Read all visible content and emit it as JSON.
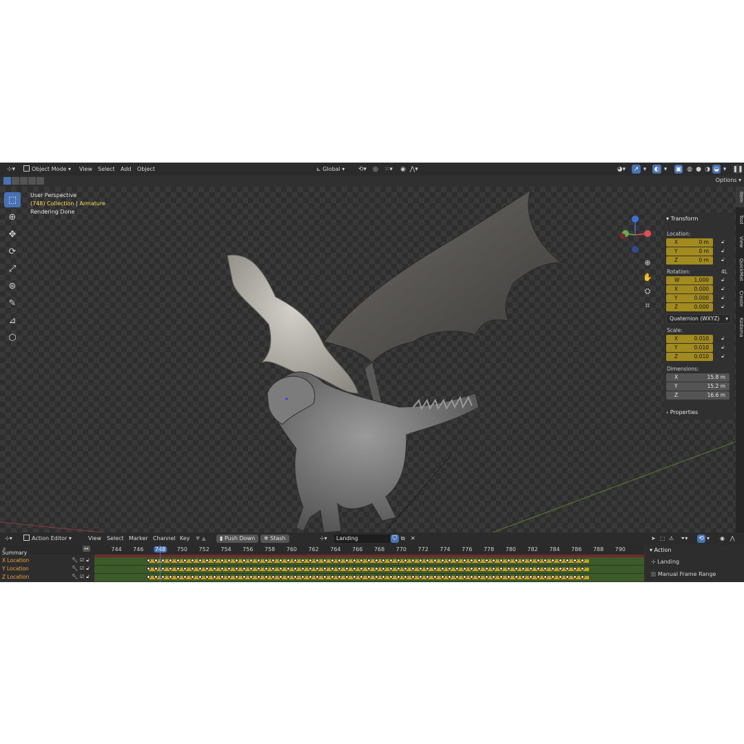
{
  "header": {
    "mode": "Object Mode",
    "menus": [
      "View",
      "Select",
      "Add",
      "Object"
    ],
    "orientation": "Global",
    "options": "Options"
  },
  "viewport": {
    "perspective": "User Perspective",
    "collection": "(748) Collection",
    "separator": "|",
    "object": "Armature",
    "status": "Rendering Done"
  },
  "transform": {
    "title": "Transform",
    "location_label": "Location:",
    "location": [
      {
        "axis": "X",
        "value": "0 m"
      },
      {
        "axis": "Y",
        "value": "0 m"
      },
      {
        "axis": "Z",
        "value": "0 m"
      }
    ],
    "rotation_label": "Rotation:",
    "rotation_mode_short": "4L",
    "rotation": [
      {
        "axis": "W",
        "value": "1.000"
      },
      {
        "axis": "X",
        "value": "0.000"
      },
      {
        "axis": "Y",
        "value": "0.000"
      },
      {
        "axis": "Z",
        "value": "0.000"
      }
    ],
    "rotation_mode": "Quaternion (WXYZ)",
    "scale_label": "Scale:",
    "scale": [
      {
        "axis": "X",
        "value": "0.010"
      },
      {
        "axis": "Y",
        "value": "0.010"
      },
      {
        "axis": "Z",
        "value": "0.010"
      }
    ],
    "dimensions_label": "Dimensions:",
    "dimensions": [
      {
        "axis": "X",
        "value": "15.8 m"
      },
      {
        "axis": "Y",
        "value": "15.2 m"
      },
      {
        "axis": "Z",
        "value": "16.6 m"
      }
    ],
    "properties": "Properties"
  },
  "side_tabs": [
    "Item",
    "Tool",
    "View",
    "QuickMat",
    "Create",
    "Kodama"
  ],
  "action_editor": {
    "mode": "Action Editor",
    "menus": [
      "View",
      "Select",
      "Marker",
      "Channel",
      "Key"
    ],
    "push_down": "Push Down",
    "stash": "Stash",
    "action_name": "Landing",
    "frames": [
      "744",
      "746",
      "748",
      "750",
      "752",
      "754",
      "756",
      "758",
      "760",
      "762",
      "764",
      "766",
      "768",
      "770",
      "772",
      "774",
      "776",
      "778",
      "780",
      "782",
      "784",
      "786",
      "788",
      "790"
    ],
    "current_frame": "748",
    "channels": [
      "Summary",
      "X Location",
      "Y Location",
      "Z Location"
    ],
    "side": {
      "title": "Action",
      "action": "Landing",
      "manual_range": "Manual Frame Range"
    }
  },
  "colors": {
    "accent": "#4772b3",
    "keyed_field": "#a38a1f",
    "channel_text": "#f0a23c",
    "collection_text": "#ffdd55"
  }
}
